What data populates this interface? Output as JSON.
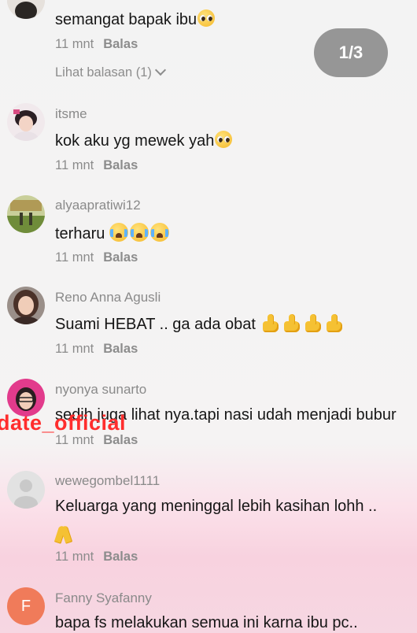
{
  "page_indicator": "1/3",
  "watermark": "date_official",
  "comments": [
    {
      "text": "semangat bapak ibu",
      "time": "11 mnt",
      "reply": "Balas",
      "view_replies": "Lihat balasan (1)",
      "emoji": "pleading-face"
    },
    {
      "username": "itsme",
      "text": "kok aku yg mewek yah",
      "time": "11 mnt",
      "reply": "Balas",
      "emoji": "pleading-face"
    },
    {
      "username": "alyaapratiwi12",
      "text": "terharu ",
      "time": "11 mnt",
      "reply": "Balas",
      "emoji": "loudly-crying-face x3"
    },
    {
      "username": "Reno Anna Agusli",
      "text": "Suami HEBAT .. ga ada obat ",
      "time": "11 mnt",
      "reply": "Balas",
      "emoji": "thumbs-up x4"
    },
    {
      "username": "nyonya sunarto",
      "text": "sedih juga lihat nya.tapi nasi udah menjadi bubur",
      "time": "11 mnt",
      "reply": "Balas"
    },
    {
      "username": "wewegombel1111",
      "text": "Keluarga yang meninggal lebih kasihan lohh ..",
      "time": "11 mnt",
      "reply": "Balas",
      "emoji": "folded-hands"
    },
    {
      "username": "Fanny Syafanny",
      "avatar_letter": "F",
      "text": "bapa fs melakukan semua ini karna ibu pc.."
    }
  ],
  "colors": {
    "avatar_letter_bg": "#f07b5a",
    "watermark": "#ff2d2d",
    "pill": "#8f8f8f"
  }
}
